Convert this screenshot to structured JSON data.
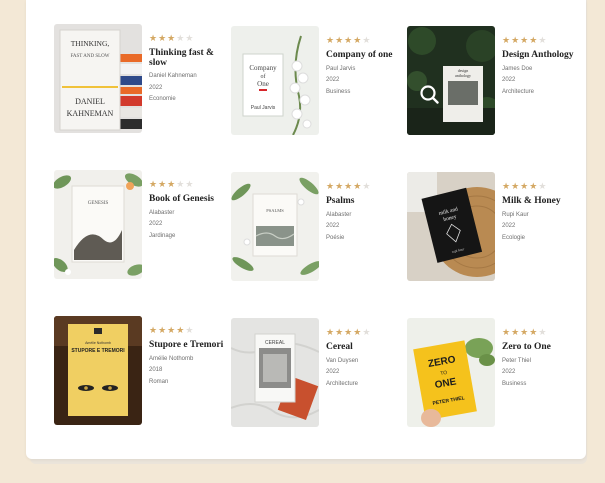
{
  "books": [
    {
      "title": "Thinking fast & slow",
      "author": "Daniel Kahneman",
      "year": "2022",
      "genre": "Economie",
      "rating": 3,
      "cover": {
        "lines": [
          "THINKING,",
          "FAST AND SLOW",
          "DANIEL",
          "KAHNEMAN"
        ]
      }
    },
    {
      "title": "Company of one",
      "author": "Paul Jarvis",
      "year": "2022",
      "genre": "Business",
      "rating": 4,
      "cover": {
        "lines": [
          "Company",
          "of",
          "One",
          "Paul Jarvis"
        ]
      }
    },
    {
      "title": "Design Anthology",
      "author": "James Doe",
      "year": "2022",
      "genre": "Architecture",
      "rating": 4,
      "cover": {
        "lines": [
          "design",
          "anthology"
        ]
      }
    },
    {
      "title": "Book of Genesis",
      "author": "Alabaster",
      "year": "2022",
      "genre": "Jardinage",
      "rating": 3,
      "cover": {
        "lines": [
          "GENESIS"
        ]
      }
    },
    {
      "title": "Psalms",
      "author": "Alabaster",
      "year": "2022",
      "genre": "Poésie",
      "rating": 4,
      "cover": {
        "lines": [
          "PSALMS"
        ]
      }
    },
    {
      "title": "Milk & Honey",
      "author": "Rupi Kaur",
      "year": "2022",
      "genre": "Ecologie",
      "rating": 4,
      "cover": {
        "lines": [
          "milk and",
          "honey",
          "rupi kaur"
        ]
      }
    },
    {
      "title": "Stupore e Tremori",
      "author": "Amélie Nothomb",
      "year": "2018",
      "genre": "Roman",
      "rating": 4,
      "cover": {
        "lines": [
          "Amélie Nothomb",
          "STUPORE E TREMORI"
        ]
      }
    },
    {
      "title": "Cereal",
      "author": "Van Duysen",
      "year": "2022",
      "genre": "Architecture",
      "rating": 4,
      "cover": {
        "lines": [
          "CEREAL"
        ]
      }
    },
    {
      "title": "Zero to One",
      "author": "Peter Thiel",
      "year": "2022",
      "genre": "Business",
      "rating": 4,
      "cover": {
        "lines": [
          "ZERO",
          "TO",
          "ONE",
          "PETER THIEL"
        ]
      }
    }
  ],
  "icons": {
    "search": "search-icon",
    "star": "star-icon"
  },
  "colors": {
    "star_on": "#d4a863",
    "star_off": "#e2dfdb",
    "background": "#f3e8d6"
  }
}
